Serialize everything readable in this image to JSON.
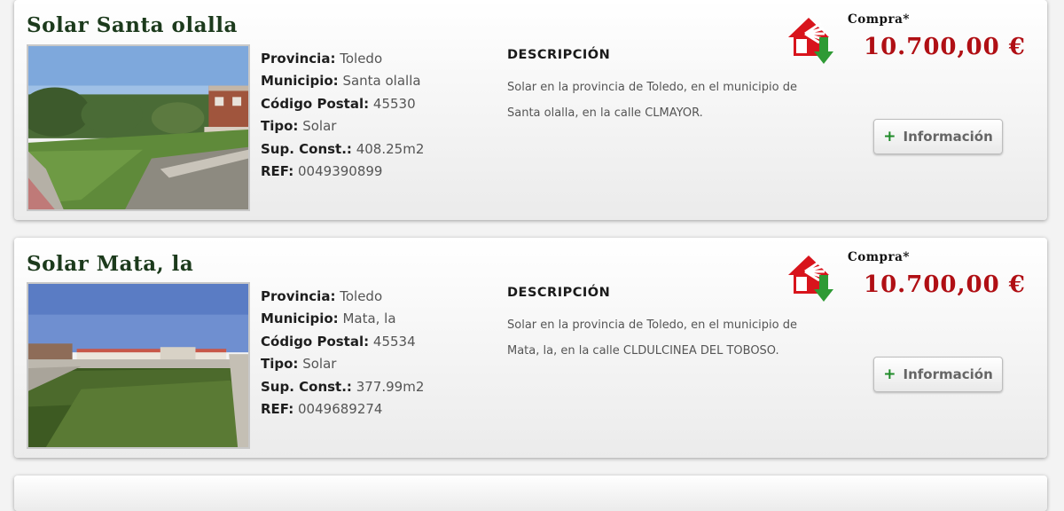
{
  "listings": [
    {
      "title": "Solar Santa olalla",
      "specs": [
        {
          "label": "Provincia:",
          "value": "Toledo"
        },
        {
          "label": "Municipio:",
          "value": "Santa olalla"
        },
        {
          "label": "Código Postal:",
          "value": "45530"
        },
        {
          "label": "Tipo:",
          "value": "Solar"
        },
        {
          "label": "Sup. Const.:",
          "value": "408.25m2"
        },
        {
          "label": "REF:",
          "value": "0049390899"
        }
      ],
      "description_title": "DESCRIPCIÓN",
      "description": "Solar en la provincia de Toledo, en el municipio de Santa olalla, en la calle CLMAYOR.",
      "buy_label": "Compra*",
      "price": "10.700,00 €",
      "info_button": {
        "icon": "plus-icon",
        "plus": "+",
        "label": "Información"
      }
    },
    {
      "title": "Solar Mata, la",
      "specs": [
        {
          "label": "Provincia:",
          "value": "Toledo"
        },
        {
          "label": "Municipio:",
          "value": "Mata, la"
        },
        {
          "label": "Código Postal:",
          "value": "45534"
        },
        {
          "label": "Tipo:",
          "value": "Solar"
        },
        {
          "label": "Sup. Const.:",
          "value": "377.99m2"
        },
        {
          "label": "REF:",
          "value": "0049689274"
        }
      ],
      "description_title": "DESCRIPCIÓN",
      "description": "Solar en la provincia de Toledo, en el municipio de Mata, la, en la calle CLDULCINEA DEL TOBOSO.",
      "buy_label": "Compra*",
      "price": "10.700,00 €",
      "info_button": {
        "icon": "plus-icon",
        "plus": "+",
        "label": "Información"
      }
    }
  ],
  "colors": {
    "title": "#1c3a1c",
    "price": "#b00f14",
    "plus": "#1e8a28",
    "logo_red": "#d8141c",
    "logo_green": "#2e9a34"
  }
}
